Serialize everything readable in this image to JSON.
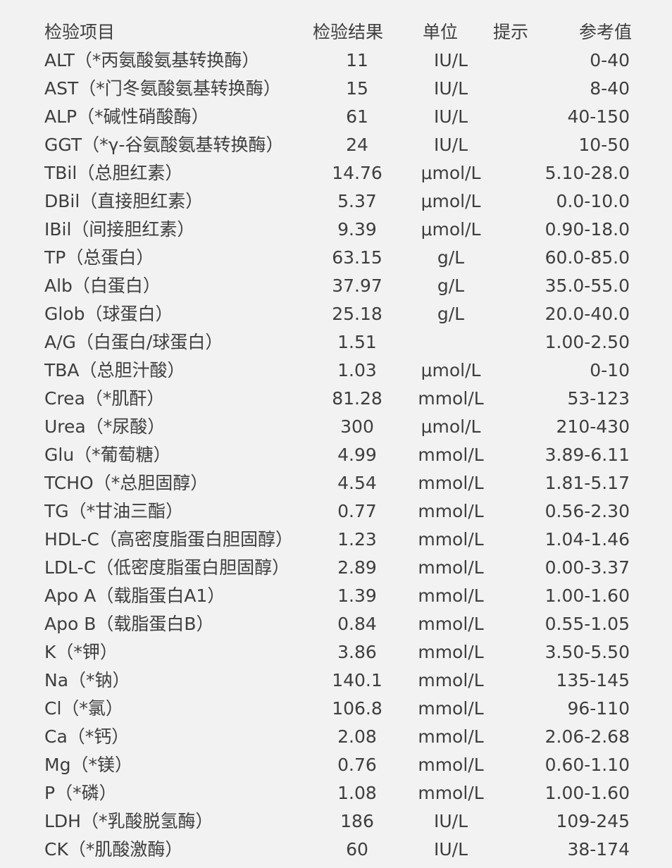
{
  "headers": {
    "item": "检验项目",
    "result": "检验结果",
    "unit": "单位",
    "flag": "提示",
    "reference": "参考值"
  },
  "rows": [
    {
      "item": "ALT（*丙氨酸氨基转换酶）",
      "result": "11",
      "unit": "IU/L",
      "flag": "",
      "reference": "0-40"
    },
    {
      "item": "AST（*门冬氨酸氨基转换酶）",
      "result": "15",
      "unit": "IU/L",
      "flag": "",
      "reference": "8-40"
    },
    {
      "item": "ALP（*碱性硝酸酶）",
      "result": "61",
      "unit": "IU/L",
      "flag": "",
      "reference": "40-150"
    },
    {
      "item": "GGT（*γ-谷氨酸氨基转换酶）",
      "result": "24",
      "unit": "IU/L",
      "flag": "",
      "reference": "10-50"
    },
    {
      "item": "TBil（总胆红素）",
      "result": "14.76",
      "unit": "μmol/L",
      "flag": "",
      "reference": "5.10-28.0"
    },
    {
      "item": "DBil（直接胆红素）",
      "result": "5.37",
      "unit": "μmol/L",
      "flag": "",
      "reference": "0.0-10.0"
    },
    {
      "item": "IBil（间接胆红素）",
      "result": "9.39",
      "unit": "μmol/L",
      "flag": "",
      "reference": "0.90-18.0"
    },
    {
      "item": "TP（总蛋白）",
      "result": "63.15",
      "unit": "g/L",
      "flag": "",
      "reference": "60.0-85.0"
    },
    {
      "item": "Alb（白蛋白）",
      "result": "37.97",
      "unit": "g/L",
      "flag": "",
      "reference": "35.0-55.0"
    },
    {
      "item": "Glob（球蛋白）",
      "result": "25.18",
      "unit": "g/L",
      "flag": "",
      "reference": "20.0-40.0"
    },
    {
      "item": "A/G（白蛋白/球蛋白）",
      "result": "1.51",
      "unit": "",
      "flag": "",
      "reference": "1.00-2.50"
    },
    {
      "item": "TBA（总胆汁酸）",
      "result": "1.03",
      "unit": "μmol/L",
      "flag": "",
      "reference": "0-10"
    },
    {
      "item": "Crea（*肌酐）",
      "result": "81.28",
      "unit": "mmol/L",
      "flag": "",
      "reference": "53-123"
    },
    {
      "item": "Urea（*尿酸）",
      "result": "300",
      "unit": "μmol/L",
      "flag": "",
      "reference": "210-430"
    },
    {
      "item": "Glu（*葡萄糖）",
      "result": "4.99",
      "unit": "mmol/L",
      "flag": "",
      "reference": "3.89-6.11"
    },
    {
      "item": "TCHO（*总胆固醇）",
      "result": "4.54",
      "unit": "mmol/L",
      "flag": "",
      "reference": "1.81-5.17"
    },
    {
      "item": "TG（*甘油三酯）",
      "result": "0.77",
      "unit": "mmol/L",
      "flag": "",
      "reference": "0.56-2.30"
    },
    {
      "item": "HDL-C（高密度脂蛋白胆固醇）",
      "result": "1.23",
      "unit": "mmol/L",
      "flag": "",
      "reference": "1.04-1.46"
    },
    {
      "item": "LDL-C（低密度脂蛋白胆固醇）",
      "result": "2.89",
      "unit": "mmol/L",
      "flag": "",
      "reference": "0.00-3.37"
    },
    {
      "item": "Apo A（载脂蛋白A1）",
      "result": "1.39",
      "unit": "mmol/L",
      "flag": "",
      "reference": "1.00-1.60"
    },
    {
      "item": "Apo B（载脂蛋白B）",
      "result": "0.84",
      "unit": "mmol/L",
      "flag": "",
      "reference": "0.55-1.05"
    },
    {
      "item": "K（*钾）",
      "result": "3.86",
      "unit": "mmol/L",
      "flag": "",
      "reference": "3.50-5.50"
    },
    {
      "item": "Na（*钠）",
      "result": "140.1",
      "unit": "mmol/L",
      "flag": "",
      "reference": "135-145"
    },
    {
      "item": "Cl（*氯）",
      "result": "106.8",
      "unit": "mmol/L",
      "flag": "",
      "reference": "96-110"
    },
    {
      "item": "Ca（*钙）",
      "result": "2.08",
      "unit": "mmol/L",
      "flag": "",
      "reference": "2.06-2.68"
    },
    {
      "item": "Mg（*镁）",
      "result": "0.76",
      "unit": "mmol/L",
      "flag": "",
      "reference": "0.60-1.10"
    },
    {
      "item": "P（*磷）",
      "result": "1.08",
      "unit": "mmol/L",
      "flag": "",
      "reference": "1.00-1.60"
    },
    {
      "item": "LDH（*乳酸脱氢酶）",
      "result": "186",
      "unit": "IU/L",
      "flag": "",
      "reference": "109-245"
    },
    {
      "item": "CK（*肌酸激酶）",
      "result": "60",
      "unit": "IU/L",
      "flag": "",
      "reference": "38-174"
    }
  ]
}
